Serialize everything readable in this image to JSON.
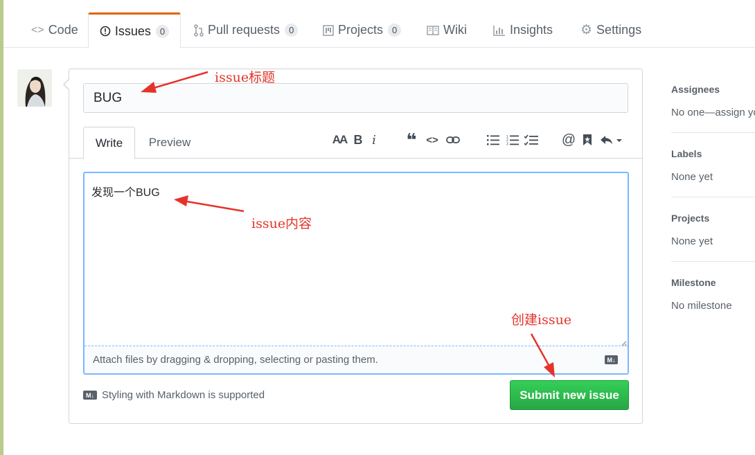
{
  "tabs": [
    {
      "label": "Code",
      "icon": "code-icon"
    },
    {
      "label": "Issues",
      "icon": "issue-opened-icon",
      "count": "0",
      "selected": true
    },
    {
      "label": "Pull requests",
      "icon": "git-pull-request-icon",
      "count": "0"
    },
    {
      "label": "Projects",
      "icon": "project-icon",
      "count": "0"
    },
    {
      "label": "Wiki",
      "icon": "book-icon"
    },
    {
      "label": "Insights",
      "icon": "graph-icon"
    },
    {
      "label": "Settings",
      "icon": "gear-icon"
    }
  ],
  "form": {
    "title_value": "BUG",
    "write_tab": "Write",
    "preview_tab": "Preview",
    "body_value": "发现一个BUG",
    "attach_text": "Attach files by dragging & dropping, selecting or pasting them.",
    "markdown_note": "Styling with Markdown is supported",
    "markdown_badge": "M↓",
    "submit_label": "Submit new issue"
  },
  "toolbar": {
    "header_icon": "AA",
    "bold_icon": "B",
    "italic_icon": "i",
    "quote_icon": "❝",
    "code_icon": "<>",
    "mention_icon": "@"
  },
  "sidebar": {
    "assignees": {
      "heading": "Assignees",
      "value": "No one—assign yourself"
    },
    "labels": {
      "heading": "Labels",
      "value": "None yet"
    },
    "projects": {
      "heading": "Projects",
      "value": "None yet"
    },
    "milestone": {
      "heading": "Milestone",
      "value": "No milestone"
    }
  },
  "annotations": {
    "title_note": "issue标题",
    "body_note": "issue内容",
    "submit_note": "创建issue"
  },
  "colors": {
    "accent_tab": "#e36209",
    "submit_green": "#28a745",
    "annotation_red": "#e5332a",
    "focus_blue": "#79b8ff"
  }
}
